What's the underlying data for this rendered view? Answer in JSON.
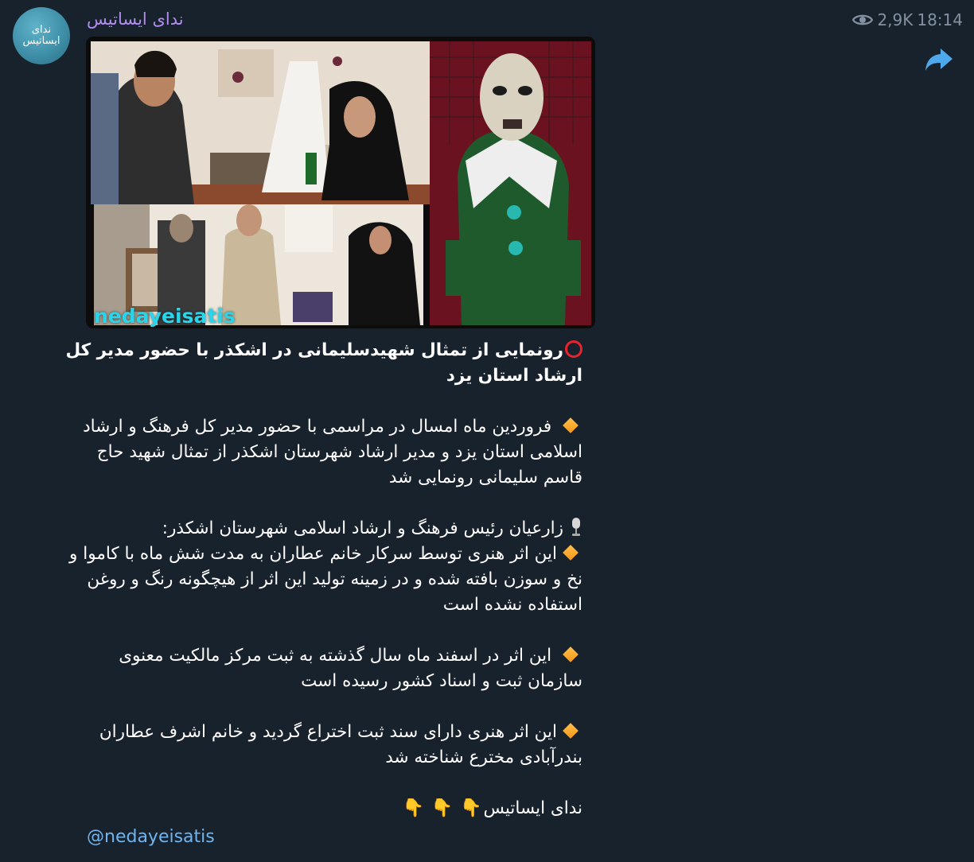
{
  "channel": {
    "name": "ندای ایساتیس",
    "avatar_text": "ندای ایساتیس"
  },
  "meta": {
    "views": "2,9K",
    "time": "18:14",
    "eye_icon": "eye-icon"
  },
  "actions": {
    "share_icon": "share-arrow-icon"
  },
  "media": {
    "watermark": "nedayeisatis"
  },
  "post": {
    "title": "رونمایی از تمثال شهیدسلیمانی در اشکذر با حضور مدیر کل ارشاد استان یزد",
    "p1": "فروردین ماه امسال در مراسمی با حضور مدیر کل فرهنگ و ارشاد اسلامی استان یزد و مدیر ارشاد شهرستان اشکذر از تمثال شهید حاج قاسم سلیمانی رونمایی شد",
    "p2_intro": "زارعیان رئیس فرهنگ و ارشاد اسلامی شهرستان اشکذر:",
    "p2_body": "این اثر هنری توسط سرکار خانم عطاران به مدت شش ماه با کاموا و نخ و سوزن بافته شده و در زمینه تولید این اثر از هیچگونه رنگ و روغن استفاده نشده است",
    "p3": "این اثر در اسفند ماه سال گذشته به ثبت مرکز مالکیت معنوی سازمان ثبت و اسناد کشور رسیده است",
    "p4": "این اثر هنری دارای سند ثبت اختراع گردید و خانم اشرف عطاران بندرآبادی مخترع شناخته شد",
    "signature": "ندای ایساتیس",
    "handle": "@nedayeisatis"
  },
  "colors": {
    "background": "#18222d",
    "channel_name": "#b38cf0",
    "link": "#6fb4ee",
    "meta": "#8391a0",
    "watermark": "#27d6ec"
  }
}
